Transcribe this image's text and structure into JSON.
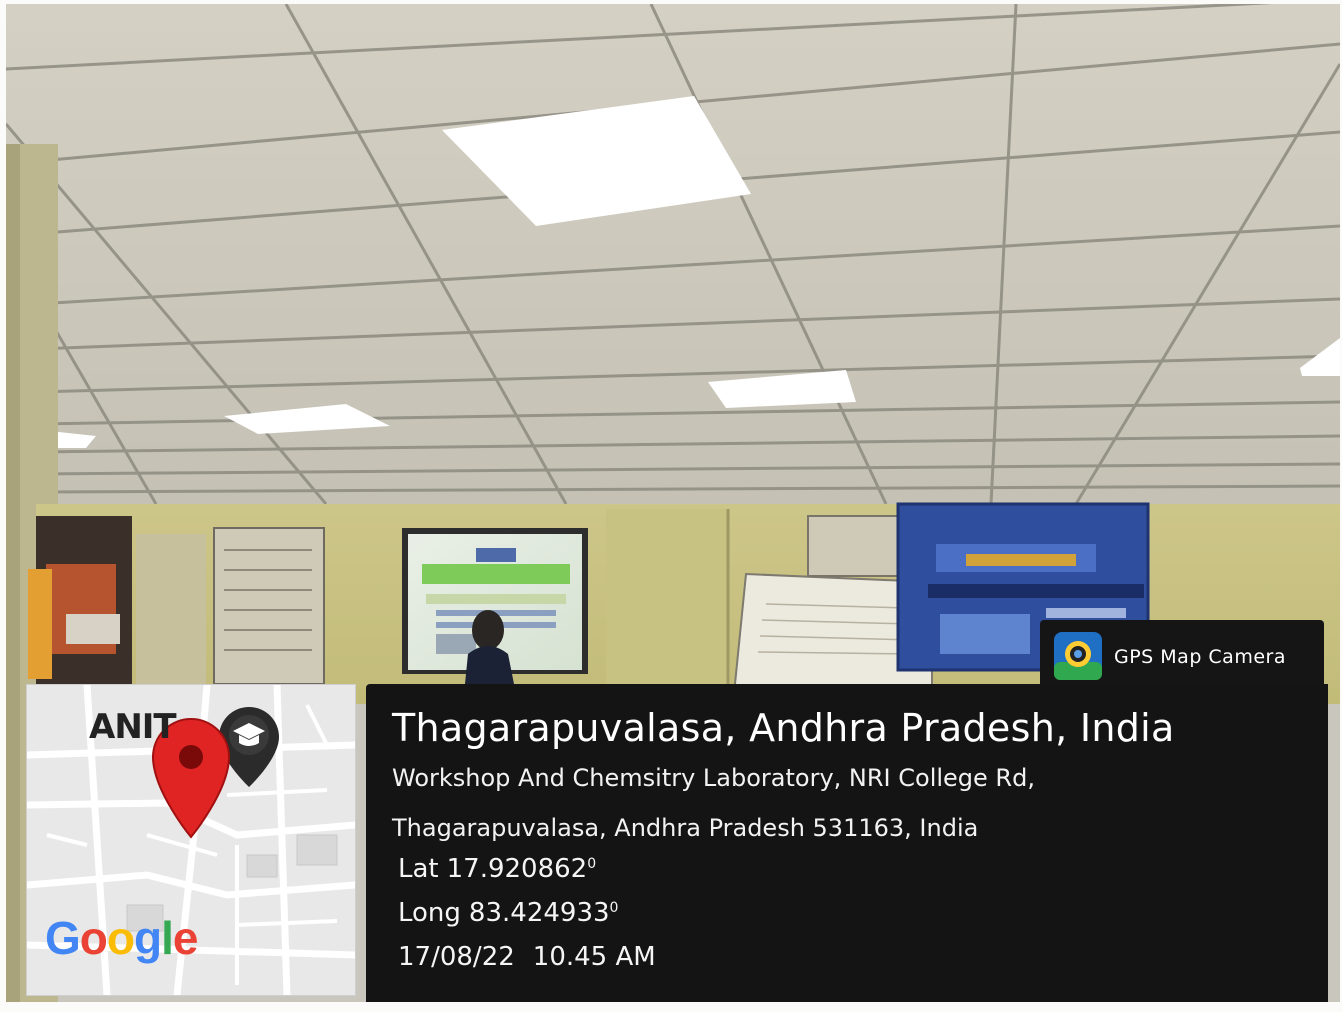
{
  "location": {
    "title": "Thagarapuvalasa, Andhra Pradesh, India",
    "address_line1": "Workshop And Chemsitry Laboratory, NRI College Rd,",
    "address_line2": "Thagarapuvalasa, Andhra Pradesh 531163, India"
  },
  "coordinates": {
    "lat_label": "Lat",
    "lat_value": "17.920862",
    "long_label": "Long",
    "long_value": "83.424933",
    "degree_mark": "0"
  },
  "timestamp": {
    "date": "17/08/22",
    "time": "10.45 AM"
  },
  "app_badge": {
    "label": "GPS Map Camera",
    "icon": "gps-map-camera-app-icon"
  },
  "map": {
    "place_label": "ANIT",
    "logo_text": "Google",
    "logo_letters": [
      "G",
      "o",
      "o",
      "g",
      "l",
      "e"
    ],
    "logo_colors": [
      "#4285f4",
      "#ea4335",
      "#fbbc05",
      "#4285f4",
      "#34a853",
      "#ea4335"
    ],
    "pin_icon": "map-pin-icon",
    "school_icon": "school-marker-icon"
  },
  "colors": {
    "panel": "#141414",
    "pin_red": "#e02424",
    "banner_blue": "#2f4f9e",
    "wall": "#c9c37f"
  }
}
